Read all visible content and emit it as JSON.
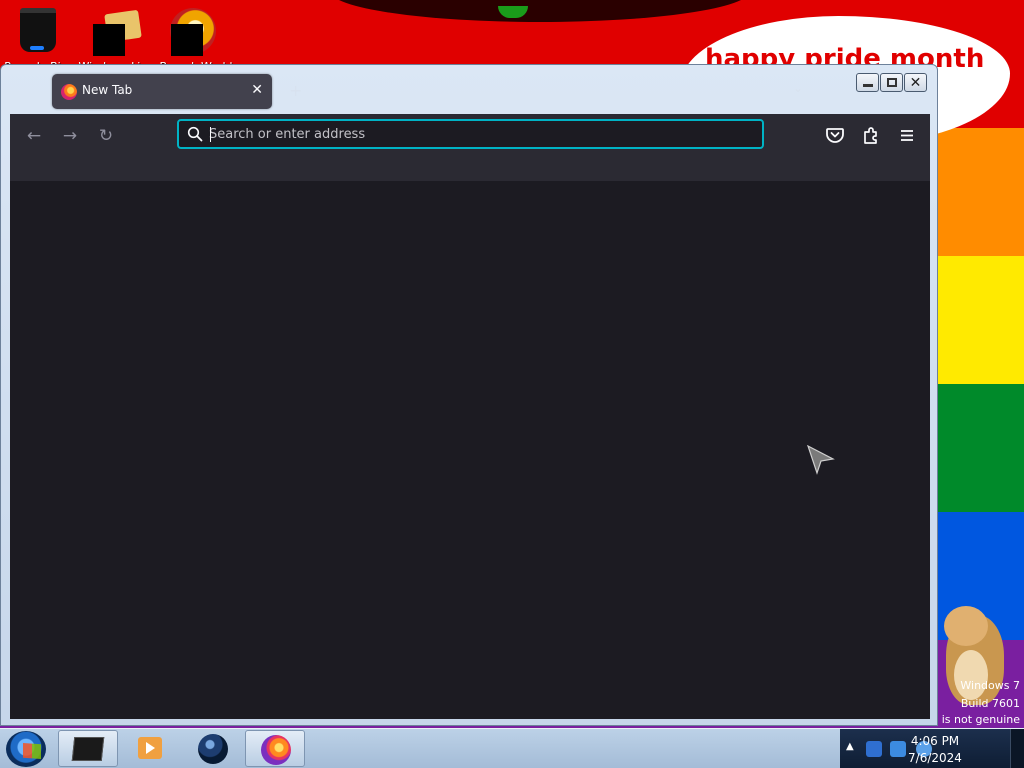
{
  "desktop": {
    "banner_text": "happy pride month",
    "stripe_colors": [
      "#e00000",
      "#ff8c00",
      "#ffea00",
      "#008a2a",
      "#0057e0",
      "#7a1fa0"
    ],
    "icons": [
      {
        "label": "Recycle Bin",
        "icon": "recycle-bin-icon"
      },
      {
        "label": "Windows Live",
        "icon": "folder-icon"
      },
      {
        "label": "Barack World",
        "icon": "globe-icon"
      }
    ],
    "watermark": {
      "line1": "Windows 7",
      "line2": "Build 7601",
      "line3": "This copy of Windows is not genuine"
    }
  },
  "browser": {
    "tab": {
      "title": "New Tab",
      "favicon": "firefox-icon",
      "close": "✕"
    },
    "newtab_symbol": "+",
    "tablist_symbol": "⌄",
    "nav": {
      "back": "←",
      "forward": "→",
      "reload": "↻"
    },
    "urlbar": {
      "placeholder": "Search or enter address",
      "value": ""
    },
    "toolbar_icons": {
      "pocket": "pocket-icon",
      "extensions": "extensions-icon",
      "menu": "menu-icon"
    },
    "accent_color": "#00b3c5",
    "background_color": "#1c1b22"
  },
  "window_controls": {
    "minimize": "minimize",
    "maximize": "maximize",
    "close": "close"
  },
  "taskbar": {
    "apps": [
      {
        "name": "terminal",
        "active": true
      },
      {
        "name": "media-player",
        "active": false
      },
      {
        "name": "globe-browser",
        "active": false
      },
      {
        "name": "firefox",
        "active": true
      }
    ],
    "clock": {
      "time": "4:06 PM",
      "date": "7/6/2024"
    }
  }
}
